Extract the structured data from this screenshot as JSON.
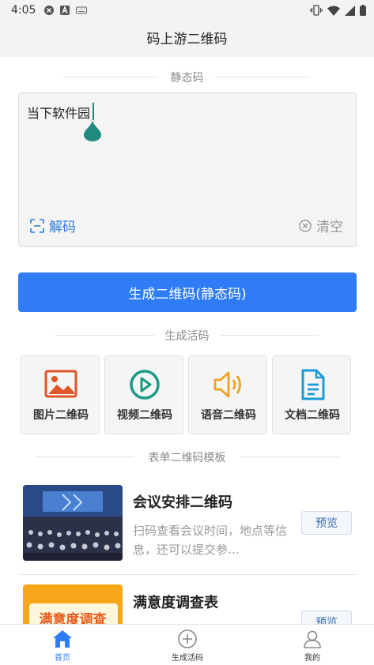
{
  "status_bar": {
    "time": "4:05"
  },
  "header": {
    "title": "码上游二维码"
  },
  "static_section": {
    "label": "静态码",
    "input_value": "当下软件园",
    "decode_label": "解码",
    "clear_label": "清空"
  },
  "generate_button": {
    "label": "生成二维码(静态码)"
  },
  "dynamic_section": {
    "label": "生成活码",
    "tiles": [
      {
        "label": "图片二维码",
        "icon": "image-icon",
        "color": "#e0552a"
      },
      {
        "label": "视频二维码",
        "icon": "play-circle-icon",
        "color": "#1b9a83"
      },
      {
        "label": "语音二维码",
        "icon": "speaker-icon",
        "color": "#f0a020"
      },
      {
        "label": "文档二维码",
        "icon": "document-icon",
        "color": "#1b9ad8"
      }
    ]
  },
  "templates_section": {
    "label": "表单二维码模板",
    "items": [
      {
        "title": "会议安排二维码",
        "description": "扫码查看会议时间，地点等信息，还可以提交参…",
        "preview_label": "预览"
      },
      {
        "title": "满意度调查表",
        "thumb_text": "满意度调查",
        "preview_label": "预览"
      }
    ]
  },
  "bottom_nav": {
    "items": [
      {
        "label": "首页",
        "icon": "home-icon",
        "active": true
      },
      {
        "label": "生成活码",
        "icon": "plus-circle-icon",
        "active": false
      },
      {
        "label": "我的",
        "icon": "user-icon",
        "active": false
      }
    ]
  },
  "colors": {
    "accent": "#2f7cf6",
    "link": "#2f7bd7",
    "muted": "#8a8a8a"
  }
}
